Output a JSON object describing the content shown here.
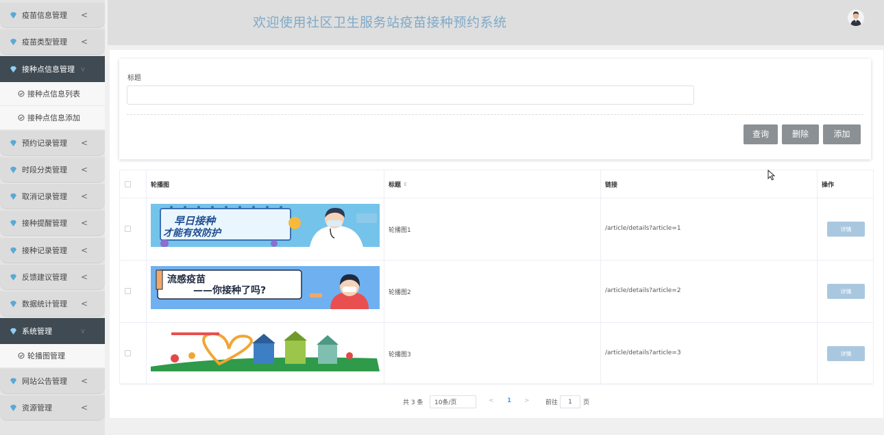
{
  "sidebar": {
    "menus": [
      {
        "label": "疫苗信息管理",
        "chevron": "<"
      },
      {
        "label": "疫苗类型管理",
        "chevron": "<"
      },
      {
        "label": "接种点信息管理",
        "chevron": "v"
      },
      {
        "label": "预约记录管理",
        "chevron": "<"
      },
      {
        "label": "时段分类管理",
        "chevron": "<"
      },
      {
        "label": "取消记录管理",
        "chevron": "<"
      },
      {
        "label": "接种提醒管理",
        "chevron": "<"
      },
      {
        "label": "接种记录管理",
        "chevron": "<"
      },
      {
        "label": "反馈建议管理",
        "chevron": "<"
      },
      {
        "label": "数据统计管理",
        "chevron": "<"
      },
      {
        "label": "系统管理",
        "chevron": "v"
      },
      {
        "label": "网站公告管理",
        "chevron": "<"
      },
      {
        "label": "资源管理",
        "chevron": "<"
      }
    ],
    "subs": [
      {
        "label": "接种点信息列表"
      },
      {
        "label": "接种点信息添加"
      },
      {
        "label": "轮播图管理"
      }
    ],
    "colors": {
      "active_bg": "#3f4a52",
      "gem": "#5aa9d6"
    }
  },
  "header": {
    "title": "欢迎使用社区卫生服务站疫苗接种预约系统",
    "avatar_icon": "user-avatar"
  },
  "search": {
    "label": "标题",
    "value": "",
    "buttons": {
      "query": "查询",
      "delete": "删除",
      "add": "添加"
    }
  },
  "table": {
    "headers": {
      "image": "轮播图",
      "title": "标题",
      "sort": "⇕",
      "link": "链接",
      "action": "操作"
    },
    "rows": [
      {
        "title": "轮播图1",
        "link": "/article/details?article=1",
        "action": "详情",
        "banner": {
          "line1": "早日接种",
          "line2": "才能有效防护"
        }
      },
      {
        "title": "轮播图2",
        "link": "/article/details?article=2",
        "action": "详情",
        "banner": {
          "line1": "流感疫苗",
          "line2": "——你接种了吗?"
        }
      },
      {
        "title": "轮播图3",
        "link": "/article/details?article=3",
        "action": "详情",
        "banner": {
          "line1": "",
          "line2": ""
        }
      }
    ]
  },
  "pager": {
    "total": "共 3 条",
    "page_size": "10条/页",
    "prev": "<",
    "current": "1",
    "next": ">",
    "goto_prefix": "前往",
    "goto_value": "1",
    "goto_suffix": "页"
  }
}
